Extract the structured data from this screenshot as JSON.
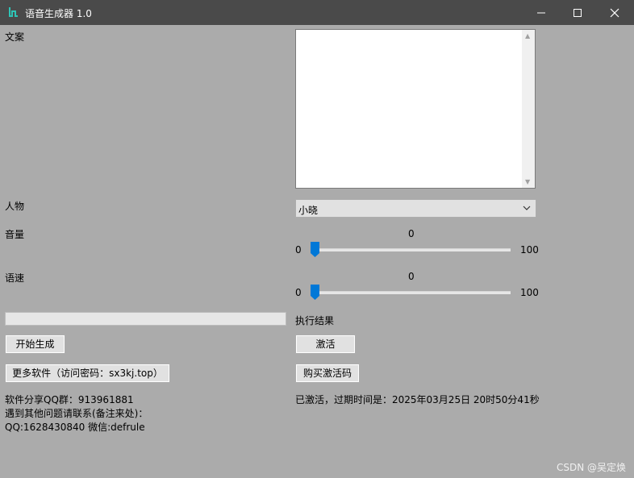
{
  "window": {
    "title": "语音生成器 1.0",
    "controls": [
      "minimize-icon",
      "maximize-icon",
      "close-icon"
    ]
  },
  "form": {
    "text_label": "文案",
    "text_value": "",
    "character_label": "人物",
    "character_selected": "小晓",
    "volume_label": "音量",
    "volume_value": "0",
    "volume_min": "0",
    "volume_max": "100",
    "speed_label": "语速",
    "speed_value": "0",
    "speed_min": "0",
    "speed_max": "100",
    "progress_percent": 0,
    "result_label": "执行结果"
  },
  "buttons": {
    "start": "开始生成",
    "activate": "激活",
    "more_software": "更多软件（访问密码：sx3kj.top）",
    "buy_code": "购买激活码"
  },
  "info": {
    "qq_group": "软件分享QQ群：913961881",
    "contact_line": "遇到其他问题请联系(备注来处)：",
    "contact_ids": "QQ:1628430840 微信:defrule",
    "activation_status": "已激活，过期时间是：2025年03月25日 20时50分41秒"
  },
  "watermark": "CSDN @吴定焕",
  "colors": {
    "titlebar": "#4a4a4a",
    "background": "#ababab",
    "accent": "#0078d7",
    "icon_teal": "#2ec4b6"
  }
}
